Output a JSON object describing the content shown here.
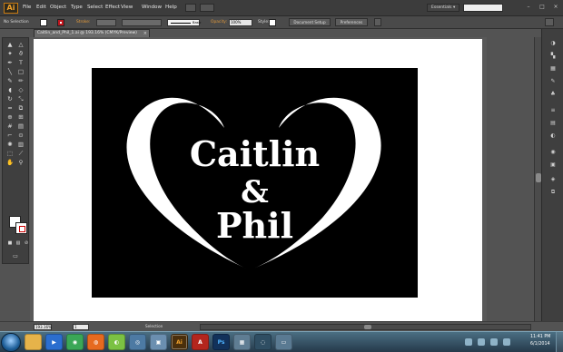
{
  "app": {
    "logo_text": "Ai"
  },
  "menu": [
    "File",
    "Edit",
    "Object",
    "Type",
    "Select",
    "Effect",
    "View",
    "Window",
    "Help"
  ],
  "workspace": {
    "label": "Essentials ▾"
  },
  "control_bar": {
    "selection_state": "No Selection",
    "stroke_label": "Stroke:",
    "stroke_style": "Basic",
    "opacity_label": "Opacity:",
    "opacity_value": "100%",
    "style_label": "Style:",
    "document_setup_button": "Document Setup",
    "preferences_button": "Preferences",
    "fill_color": "#ffffff",
    "stroke_color": "#c0161f"
  },
  "document": {
    "tab_title": "Caitlin_and_Phil_1.ai @ 193.16% (CMYK/Preview)",
    "close_glyph": "×"
  },
  "artwork": {
    "line1": "Caitlin",
    "line2": "&",
    "line3": "Phil",
    "background": "#000000",
    "foreground": "#ffffff"
  },
  "status_bar": {
    "zoom": "193.16%",
    "page": "1",
    "tool": "Selection"
  },
  "taskbar": {
    "items": [
      {
        "name": "explorer-icon",
        "glyph": "",
        "color": "#e6b34a"
      },
      {
        "name": "media-player-icon",
        "glyph": "▶",
        "color": "#2b6ecf"
      },
      {
        "name": "chrome-icon",
        "glyph": "◉",
        "color": "#3aa757"
      },
      {
        "name": "firefox-icon",
        "glyph": "◍",
        "color": "#e66a1f"
      },
      {
        "name": "green-app-icon",
        "glyph": "◐",
        "color": "#7bc143"
      },
      {
        "name": "app-icon",
        "glyph": "◎",
        "color": "#4d7aa3"
      },
      {
        "name": "photo-app-icon",
        "glyph": "▣",
        "color": "#6b8fb0"
      },
      {
        "name": "illustrator-icon",
        "glyph": "Ai",
        "color": "#4a2f0c"
      },
      {
        "name": "acrobat-icon",
        "glyph": "A",
        "color": "#b3261e"
      },
      {
        "name": "photoshop-icon",
        "glyph": "Ps",
        "color": "#12315a"
      },
      {
        "name": "bridge-icon",
        "glyph": "▦",
        "color": "#5f7d93"
      },
      {
        "name": "swirl-app-icon",
        "glyph": "◌",
        "color": "#2f4e63"
      },
      {
        "name": "window-app-icon",
        "glyph": "▭",
        "color": "#5a7a92"
      }
    ],
    "time": "11:41 PM",
    "date": "6/1/2014"
  }
}
